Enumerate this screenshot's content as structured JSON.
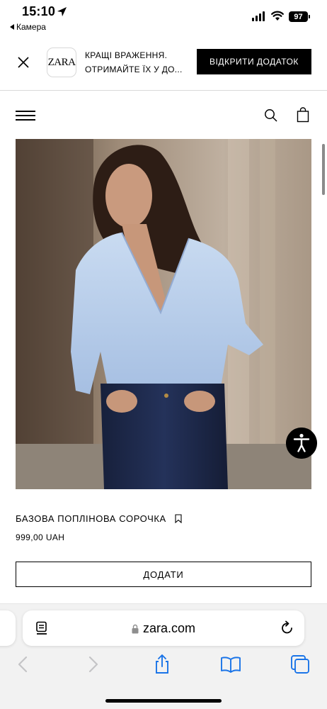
{
  "status_bar": {
    "time": "15:10",
    "back_app": "Камера",
    "battery": "97"
  },
  "app_banner": {
    "logo": "ZARA",
    "line1": "КРАЩІ ВРАЖЕННЯ.",
    "line2": "ОТРИМАЙТЕ ЇХ У ДО...",
    "open_button": "ВІДКРИТИ ДОДАТОК"
  },
  "product": {
    "name": "БАЗОВА ПОПЛІНОВА СОРОЧКА",
    "price": "999,00 UAH",
    "add_button": "ДОДАТИ"
  },
  "browser": {
    "url": "zara.com"
  },
  "colors": {
    "shirt": "#b7cdea",
    "jeans": "#1f2a4a",
    "accent": "#000000"
  },
  "icons": [
    "location-arrow-icon",
    "signal-icon",
    "wifi-icon",
    "battery-icon",
    "close-icon",
    "menu-icon",
    "search-icon",
    "shopping-bag-icon",
    "bookmark-icon",
    "accessibility-icon",
    "reader-icon",
    "lock-icon",
    "reload-icon",
    "back-icon",
    "forward-icon",
    "share-icon",
    "bookmarks-icon",
    "tabs-icon"
  ]
}
